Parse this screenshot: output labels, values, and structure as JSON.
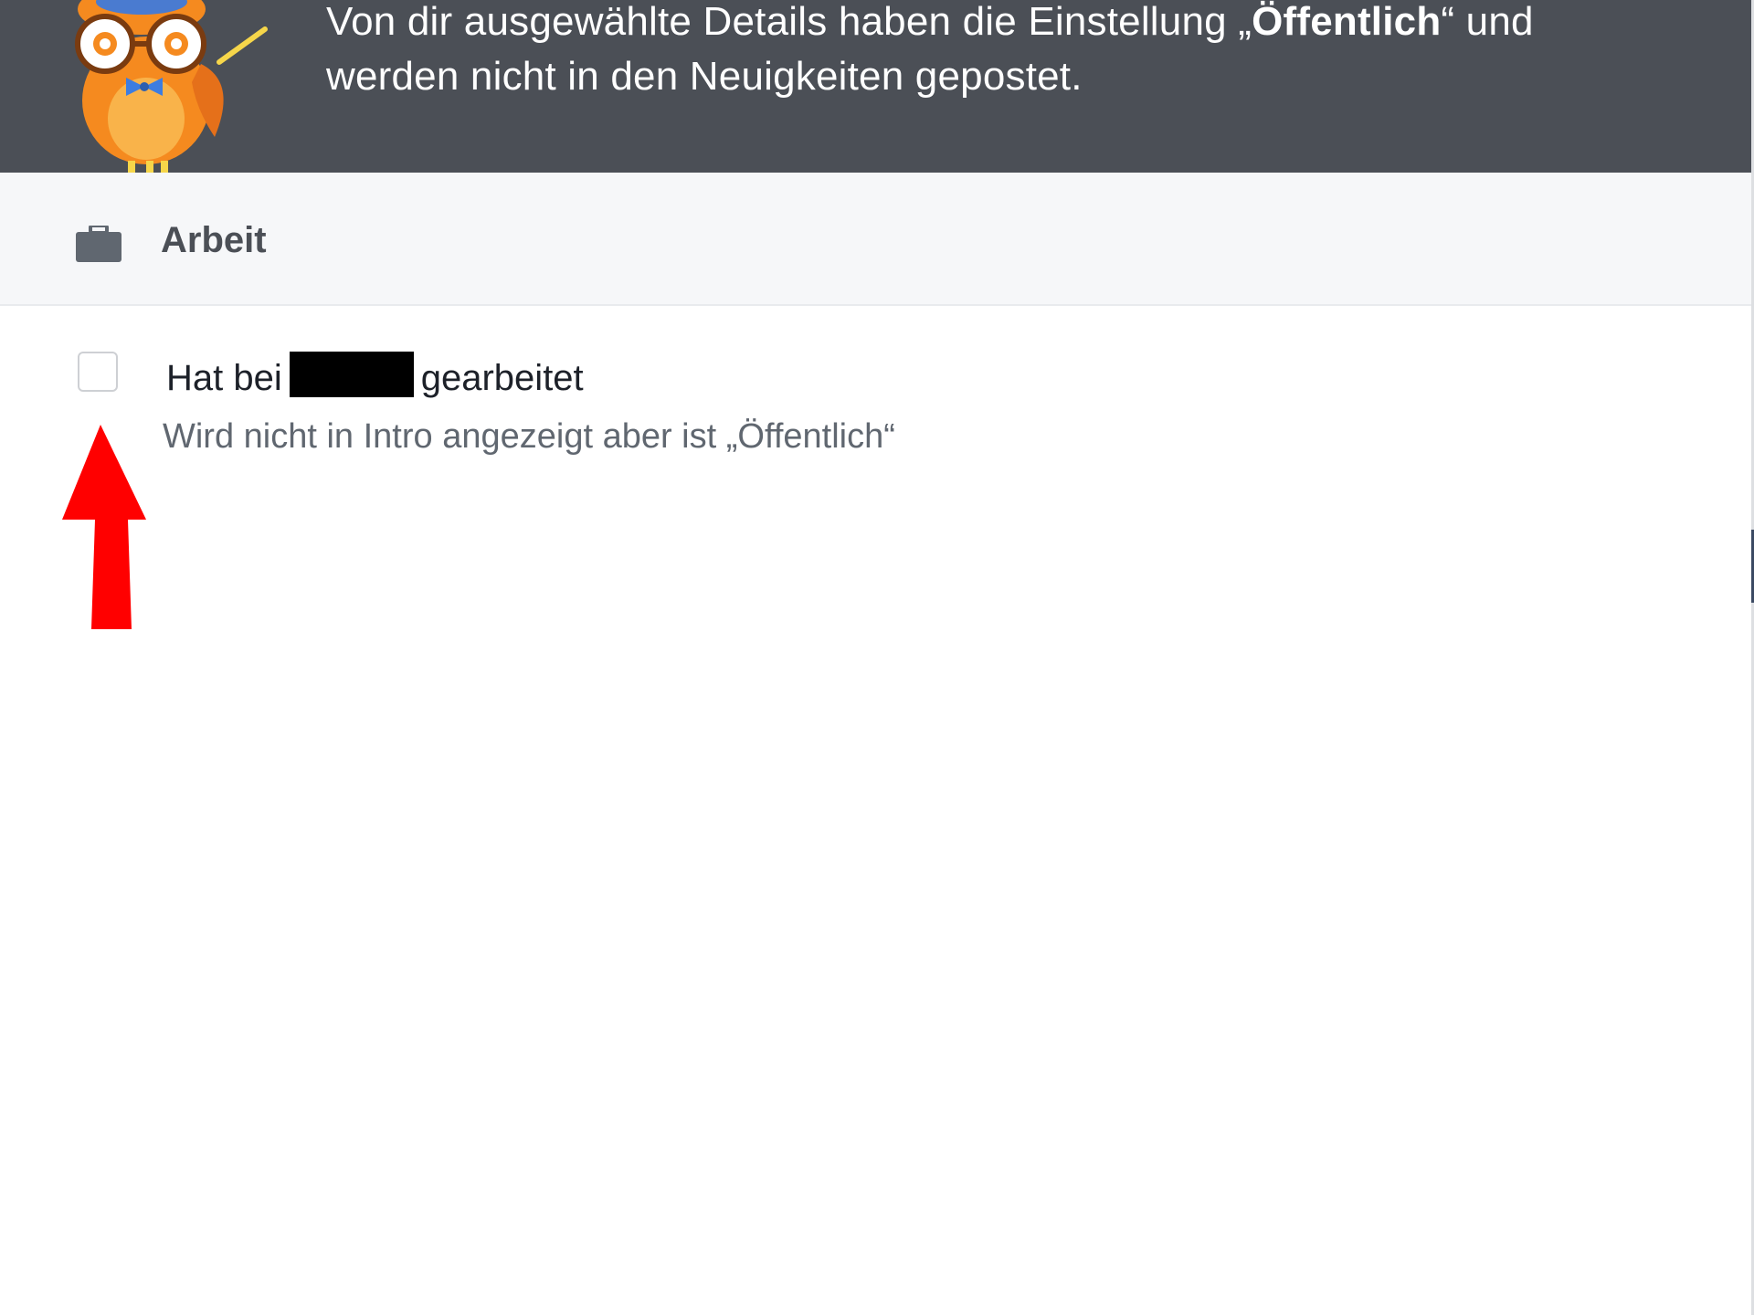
{
  "banner": {
    "line1_prefix": "Von dir ausgewählte Details haben die Einstellung „",
    "line1_bold": "Öffentlich",
    "line1_suffix": "“ und",
    "line2": "werden nicht in den Neuigkeiten gepostet."
  },
  "section": {
    "icon": "briefcase-icon",
    "title": "Arbeit"
  },
  "item": {
    "checked": false,
    "title_prefix": "Hat bei",
    "title_suffix": "gearbeitet",
    "subtitle": "Wird nicht in Intro angezeigt aber ist „Öffentlich“"
  },
  "colors": {
    "banner_bg": "#4b4f56",
    "section_bg": "#f6f7f9",
    "arrow": "#ff0000",
    "redaction": "#000000"
  }
}
